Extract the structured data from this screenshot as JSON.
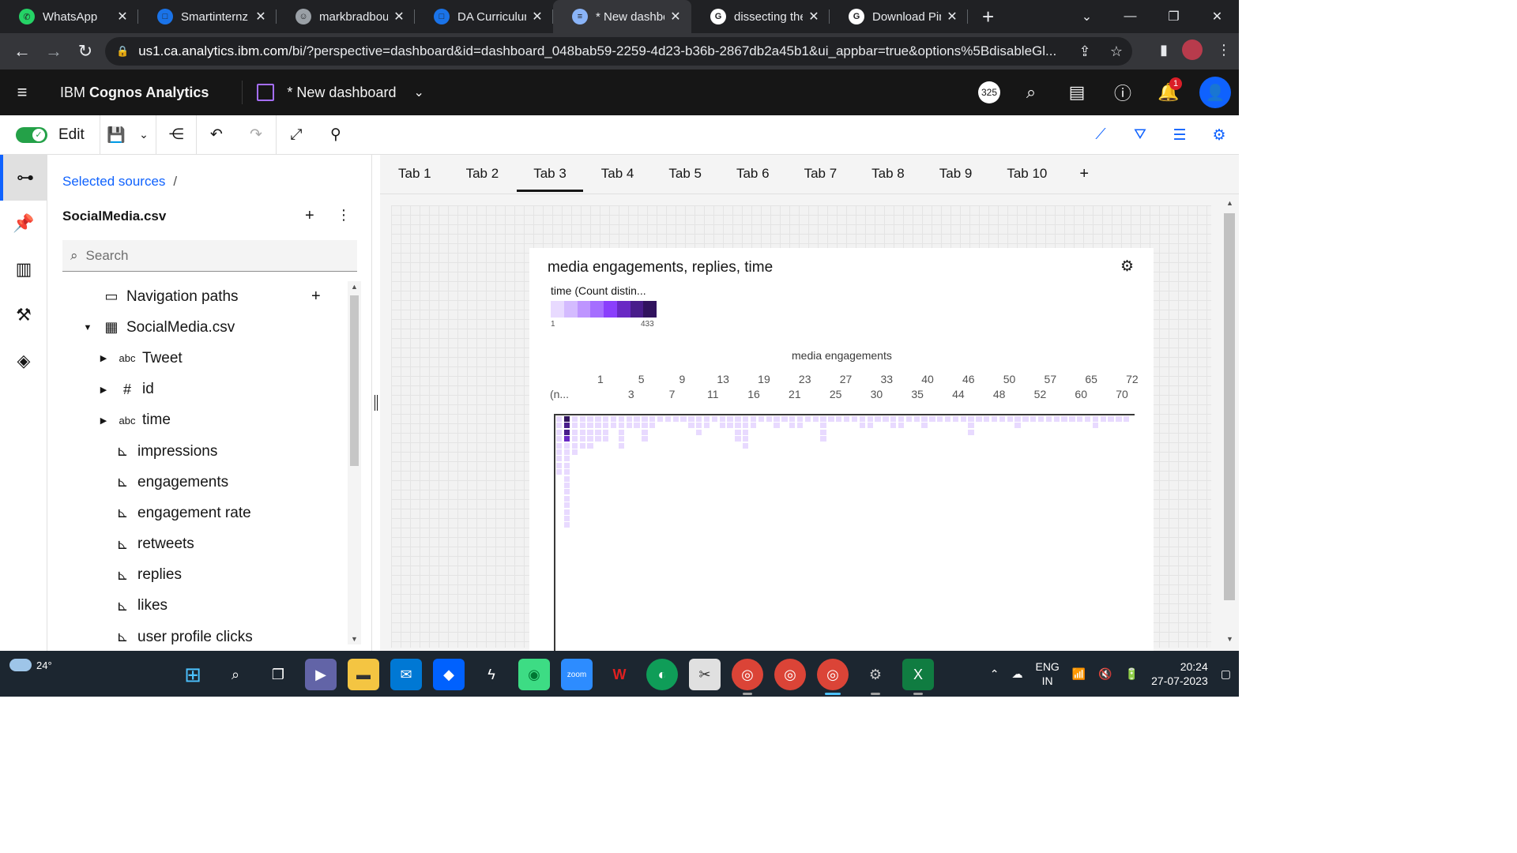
{
  "browser": {
    "tabs": [
      {
        "title": "WhatsApp",
        "favicon_color": "#25d366",
        "favicon_glyph": "✆",
        "active": false
      },
      {
        "title": "Smartinternz",
        "favicon_color": "#1a73e8",
        "favicon_glyph": "□",
        "active": false
      },
      {
        "title": "markbradbourn",
        "favicon_color": "#9aa0a6",
        "favicon_glyph": "☺",
        "active": false
      },
      {
        "title": "DA Curriculum",
        "favicon_color": "#1a73e8",
        "favicon_glyph": "□",
        "active": false
      },
      {
        "title": "* New dashboard",
        "favicon_color": "#8ab4f8",
        "favicon_glyph": "≡",
        "active": true
      },
      {
        "title": "dissecting the",
        "favicon_color": "#ffffff",
        "favicon_glyph": "G",
        "active": false
      },
      {
        "title": "Download Pint",
        "favicon_color": "#ffffff",
        "favicon_glyph": "G",
        "active": false
      }
    ],
    "url_host": "us1.ca.analytics.ibm.com",
    "url_rest": "/bi/?perspective=dashboard&id=dashboard_048bab59-2259-4d23-b36b-2867db2a45b1&ui_appbar=true&options%5BdisableGl..."
  },
  "header": {
    "brand_prefix": "IBM ",
    "brand_name": "Cognos Analytics",
    "dashboard_title": "* New dashboard",
    "count_badge": "325",
    "notification_count": "1"
  },
  "toolbar": {
    "edit_label": "Edit"
  },
  "source_panel": {
    "breadcrumb": "Selected sources",
    "breadcrumb_sep": "/",
    "source_name": "SocialMedia.csv",
    "search_placeholder": "Search",
    "tree": [
      {
        "label": "Navigation paths",
        "icon": "folder-icon",
        "glyph": "▭",
        "caret": "",
        "indent": 70,
        "plus": true
      },
      {
        "label": "SocialMedia.csv",
        "icon": "table-icon",
        "glyph": "▦",
        "caret": "▼",
        "indent": 44,
        "plus": false
      },
      {
        "label": "Tweet",
        "icon": "text-field-icon",
        "glyph": "abc",
        "caret": "▶",
        "indent": 64,
        "plus": false
      },
      {
        "label": "id",
        "icon": "number-field-icon",
        "glyph": "#",
        "caret": "▶",
        "indent": 64,
        "plus": false
      },
      {
        "label": "time",
        "icon": "text-field-icon",
        "glyph": "abc",
        "caret": "▶",
        "indent": 64,
        "plus": false
      },
      {
        "label": "impressions",
        "icon": "measure-icon",
        "glyph": "⊾",
        "caret": "",
        "indent": 84,
        "plus": false
      },
      {
        "label": "engagements",
        "icon": "measure-icon",
        "glyph": "⊾",
        "caret": "",
        "indent": 84,
        "plus": false
      },
      {
        "label": "engagement rate",
        "icon": "measure-icon",
        "glyph": "⊾",
        "caret": "",
        "indent": 84,
        "plus": false
      },
      {
        "label": "retweets",
        "icon": "measure-icon",
        "glyph": "⊾",
        "caret": "",
        "indent": 84,
        "plus": false
      },
      {
        "label": "replies",
        "icon": "measure-icon",
        "glyph": "⊾",
        "caret": "",
        "indent": 84,
        "plus": false
      },
      {
        "label": "likes",
        "icon": "measure-icon",
        "glyph": "⊾",
        "caret": "",
        "indent": 84,
        "plus": false
      },
      {
        "label": "user profile clicks",
        "icon": "measure-icon",
        "glyph": "⊾",
        "caret": "",
        "indent": 84,
        "plus": false
      }
    ]
  },
  "dashboard_tabs": [
    "Tab 1",
    "Tab 2",
    "Tab 3",
    "Tab 4",
    "Tab 5",
    "Tab 6",
    "Tab 7",
    "Tab 8",
    "Tab 9",
    "Tab 10"
  ],
  "active_tab": "Tab 3",
  "widget": {
    "title": "media engagements, replies, time",
    "legend_title": "time (Count distin...",
    "legend_min": "1",
    "legend_max": "433",
    "legend_colors": [
      "#e8daff",
      "#d4bbff",
      "#be95ff",
      "#a56eff",
      "#8a3ffc",
      "#6929c4",
      "#491d8b",
      "#31135e"
    ],
    "x_axis_title": "media engagements"
  },
  "chart_data": {
    "type": "heatmap",
    "title": "media engagements, replies, time",
    "xlabel": "media engagements",
    "color_label": "time (Count distin...",
    "color_range": [
      1,
      433
    ],
    "x_tick_labels_top": [
      "1",
      "5",
      "9",
      "13",
      "19",
      "23",
      "27",
      "33",
      "40",
      "46",
      "50",
      "57",
      "65",
      "72"
    ],
    "x_tick_labels_bottom": [
      "(n...",
      "3",
      "7",
      "11",
      "16",
      "21",
      "25",
      "30",
      "35",
      "44",
      "48",
      "52",
      "60",
      "70"
    ],
    "column_heights": [
      9,
      17,
      6,
      5,
      5,
      4,
      4,
      2,
      5,
      2,
      2,
      4,
      2,
      1,
      1,
      1,
      1,
      2,
      3,
      2,
      1,
      2,
      2,
      4,
      5,
      2,
      1,
      1,
      2,
      1,
      2,
      2,
      1,
      1,
      4,
      1,
      1,
      1,
      1,
      2,
      2,
      1,
      1,
      2,
      2,
      1,
      1,
      2,
      1,
      1,
      1,
      1,
      1,
      3,
      1,
      1,
      1,
      1,
      1,
      2,
      1,
      1,
      1,
      1,
      1,
      1,
      1,
      1,
      1,
      2,
      1,
      1,
      1,
      1
    ],
    "peak_cells": [
      [
        1,
        0,
        433
      ],
      [
        1,
        1,
        260
      ],
      [
        1,
        2,
        150
      ],
      [
        1,
        3,
        90
      ]
    ]
  },
  "taskbar": {
    "temperature": "24°",
    "lang_line1": "ENG",
    "lang_line2": "IN",
    "time": "20:24",
    "date": "27-07-2023"
  }
}
